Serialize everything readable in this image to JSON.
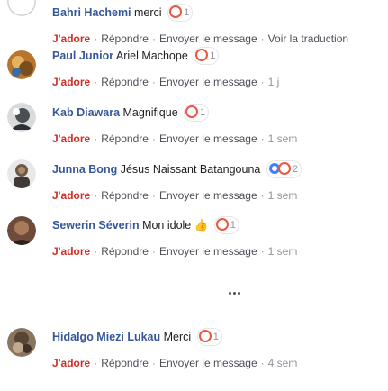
{
  "actions": {
    "like": "J'adore",
    "reply": "Répondre",
    "message": "Envoyer le message",
    "translate": "Voir la traduction",
    "separator": "·"
  },
  "reaction_icons": [
    "love-reaction-icon",
    "haha-reaction-icon"
  ],
  "colors": {
    "author": "#365899",
    "like": "#cc2f26",
    "meta": "#90949c",
    "love_reaction": "#e9573f"
  },
  "comments": [
    {
      "author": "Bahri Hachemi",
      "text": "merci",
      "reaction_count": "1",
      "time": "",
      "has_translate": true
    },
    {
      "author": "Paul Junior",
      "text": "Ariel Machope",
      "reaction_count": "1",
      "time": "1 j"
    },
    {
      "author": "Kab Diawara",
      "text": "Magnifique",
      "reaction_count": "1",
      "time": "1 sem"
    },
    {
      "author": "Junna Bong",
      "text": "Jésus Naissant Batangouna",
      "reaction_count": "2",
      "time": "1 sem"
    },
    {
      "author": "Sewerin Séverin",
      "text": "Mon idole 👍",
      "reaction_count": "1",
      "time": "1 sem"
    },
    {
      "author": "Hidalgo Miezi Lukau",
      "text": "Merci",
      "reaction_count": "1",
      "time": "4 sem"
    }
  ]
}
